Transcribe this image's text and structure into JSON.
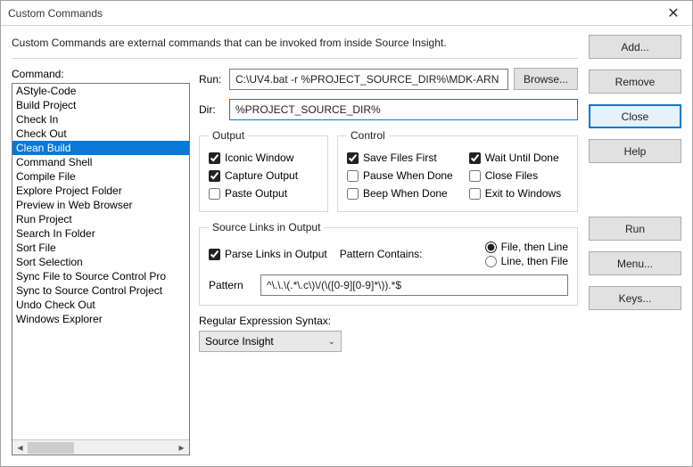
{
  "title": "Custom Commands",
  "intro": "Custom Commands are external commands that can be invoked from inside Source Insight.",
  "command_label": "Command:",
  "commands": [
    "AStyle-Code",
    "Build Project",
    "Check In",
    "Check Out",
    "Clean Build",
    "Command Shell",
    "Compile File",
    "Explore Project Folder",
    "Preview in Web Browser",
    "Run Project",
    "Search In Folder",
    "Sort File",
    "Sort Selection",
    "Sync File to Source Control Pro",
    "Sync to Source Control Project",
    "Undo Check Out",
    "Windows Explorer"
  ],
  "selected_index": 4,
  "run": {
    "label": "Run:",
    "value": "C:\\UV4.bat -r %PROJECT_SOURCE_DIR%\\MDK-ARN",
    "browse": "Browse..."
  },
  "dir": {
    "label": "Dir:",
    "value": "%PROJECT_SOURCE_DIR%"
  },
  "output": {
    "legend": "Output",
    "iconic": "Iconic Window",
    "capture": "Capture Output",
    "paste": "Paste Output"
  },
  "control": {
    "legend": "Control",
    "save": "Save Files First",
    "pause": "Pause When Done",
    "beep": "Beep When Done",
    "wait": "Wait Until Done",
    "close": "Close Files",
    "exit": "Exit to Windows"
  },
  "links": {
    "legend": "Source Links in Output",
    "parse": "Parse Links in Output",
    "pattern_contains": "Pattern Contains:",
    "radio_file_line": "File, then Line",
    "radio_line_file": "Line, then File",
    "pattern_label": "Pattern",
    "pattern_value": "^\\.\\.\\(.*\\.c\\)\\/(\\([0-9][0-9]*\\)).*$"
  },
  "regex": {
    "label": "Regular Expression Syntax:",
    "value": "Source Insight"
  },
  "buttons": {
    "add": "Add...",
    "remove": "Remove",
    "close": "Close",
    "help": "Help",
    "run": "Run",
    "menu": "Menu...",
    "keys": "Keys..."
  }
}
